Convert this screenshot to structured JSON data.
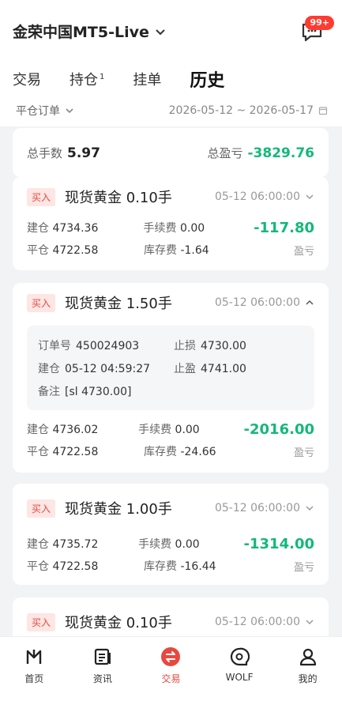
{
  "header": {
    "brand": "金荣中国MT5-Live",
    "badge": "99+"
  },
  "tabs": [
    {
      "label": "交易"
    },
    {
      "label": "持仓",
      "sup": "1"
    },
    {
      "label": "挂单"
    },
    {
      "label": "历史",
      "active": true
    }
  ],
  "filter": {
    "left": "平仓订单",
    "range": "2026-05-12 ~ 2026-05-17"
  },
  "summary": {
    "lots_label": "总手数",
    "lots": "5.97",
    "pl_label": "总盈亏",
    "pl": "-3829.76"
  },
  "orders": [
    {
      "tag": "买入",
      "product": "现货黄金",
      "lots": "0.10手",
      "time": "05-12 06:00:00",
      "open_label": "建仓",
      "open": "4734.36",
      "fee_label": "手续费",
      "fee": "0.00",
      "close_label": "平仓",
      "close": "4722.58",
      "swap_label": "库存费",
      "swap": "-1.64",
      "pl": "-117.80",
      "pl_label": "盈亏"
    },
    {
      "tag": "买入",
      "product": "现货黄金",
      "lots": "1.50手",
      "time": "05-12 06:00:00",
      "detail": {
        "order_label": "订单号",
        "order": "450024903",
        "sl_label": "止损",
        "sl": "4730.00",
        "open_time_label": "建仓",
        "open_time": "05-12 04:59:27",
        "tp_label": "止盈",
        "tp": "4741.00",
        "note_label": "备注",
        "note": "[sl 4730.00]"
      },
      "open_label": "建仓",
      "open": "4736.02",
      "fee_label": "手续费",
      "fee": "0.00",
      "close_label": "平仓",
      "close": "4722.58",
      "swap_label": "库存费",
      "swap": "-24.66",
      "pl": "-2016.00",
      "pl_label": "盈亏"
    },
    {
      "tag": "买入",
      "product": "现货黄金",
      "lots": "1.00手",
      "time": "05-12 06:00:00",
      "open_label": "建仓",
      "open": "4735.72",
      "fee_label": "手续费",
      "fee": "0.00",
      "close_label": "平仓",
      "close": "4722.58",
      "swap_label": "库存费",
      "swap": "-16.44",
      "pl": "-1314.00",
      "pl_label": "盈亏"
    },
    {
      "tag": "买入",
      "product": "现货黄金",
      "lots": "0.10手",
      "time": "05-12 06:00:00"
    }
  ],
  "nav": [
    {
      "label": "首页",
      "icon": "home-icon"
    },
    {
      "label": "资讯",
      "icon": "news-icon"
    },
    {
      "label": "交易",
      "icon": "trade-icon",
      "active": true
    },
    {
      "label": "WOLF",
      "icon": "chat-icon"
    },
    {
      "label": "我的",
      "icon": "profile-icon"
    }
  ],
  "colors": {
    "accent": "#e8483f",
    "profit_negative": "#14b87a"
  }
}
